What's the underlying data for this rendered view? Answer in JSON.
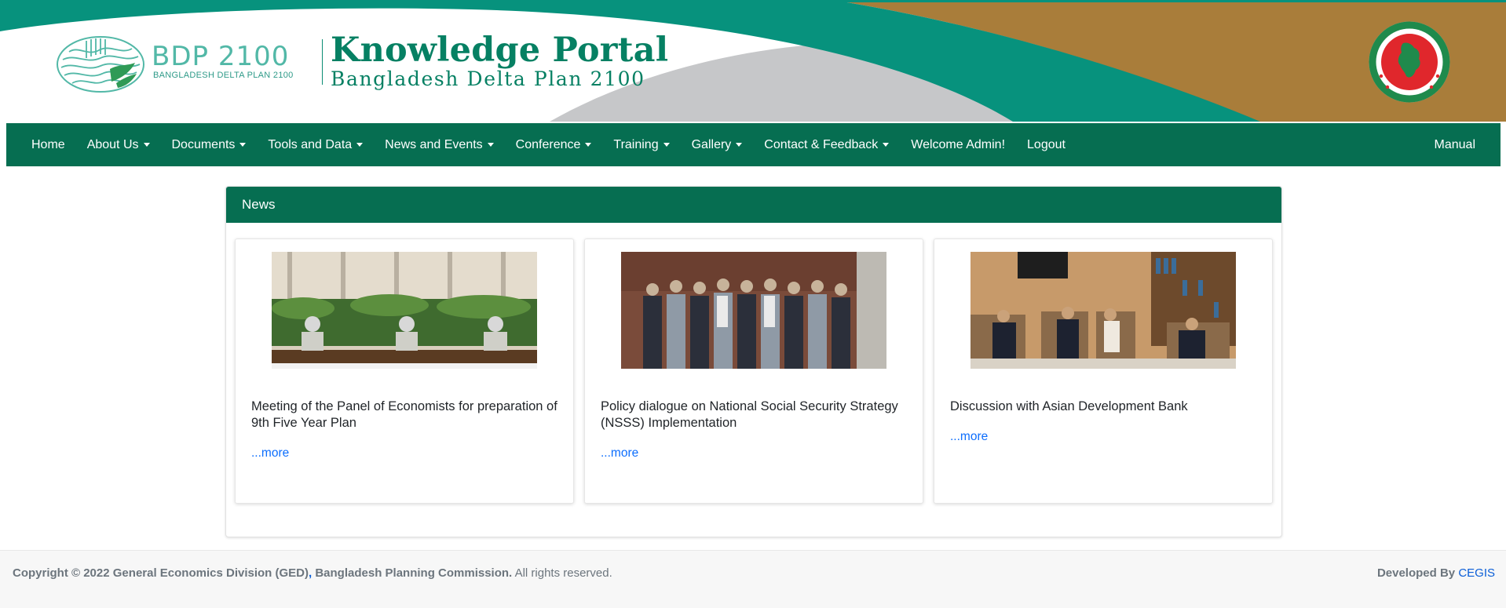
{
  "banner": {
    "bdp_title": "BDP 2100",
    "bdp_subtitle": "BANGLADESH DELTA PLAN 2100",
    "portal_title": "Knowledge Portal",
    "portal_subtitle": "Bangladesh Delta Plan 2100"
  },
  "nav": {
    "items": [
      {
        "label": "Home",
        "dropdown": false
      },
      {
        "label": "About Us",
        "dropdown": true
      },
      {
        "label": "Documents",
        "dropdown": true
      },
      {
        "label": "Tools and Data",
        "dropdown": true
      },
      {
        "label": "News and Events",
        "dropdown": true
      },
      {
        "label": "Conference",
        "dropdown": true
      },
      {
        "label": "Training",
        "dropdown": true
      },
      {
        "label": "Gallery",
        "dropdown": true
      },
      {
        "label": "Contact & Feedback",
        "dropdown": true
      },
      {
        "label": "Welcome Admin!",
        "dropdown": false
      },
      {
        "label": "Logout",
        "dropdown": false
      }
    ],
    "right": "Manual"
  },
  "news": {
    "header": "News",
    "items": [
      {
        "title": "Meeting of the Panel of Economists for preparation of 9th Five Year Plan",
        "more": "...more"
      },
      {
        "title": "Policy dialogue on National Social Security Strategy (NSSS) Implementation",
        "more": "...more"
      },
      {
        "title": "Discussion with Asian Development Bank",
        "more": "...more"
      }
    ]
  },
  "footer": {
    "copyright": "Copyright © 2022",
    "ged": "General Economics Division (GED)",
    "sep": ",",
    "commission": "Bangladesh Planning Commission.",
    "rights": "All rights reserved.",
    "developed_by": "Developed By",
    "developer": "CEGIS"
  },
  "colors": {
    "primary_green": "#066e51",
    "teal": "#0a9480",
    "gold": "#a97d3a",
    "link": "#0b5ed7"
  }
}
